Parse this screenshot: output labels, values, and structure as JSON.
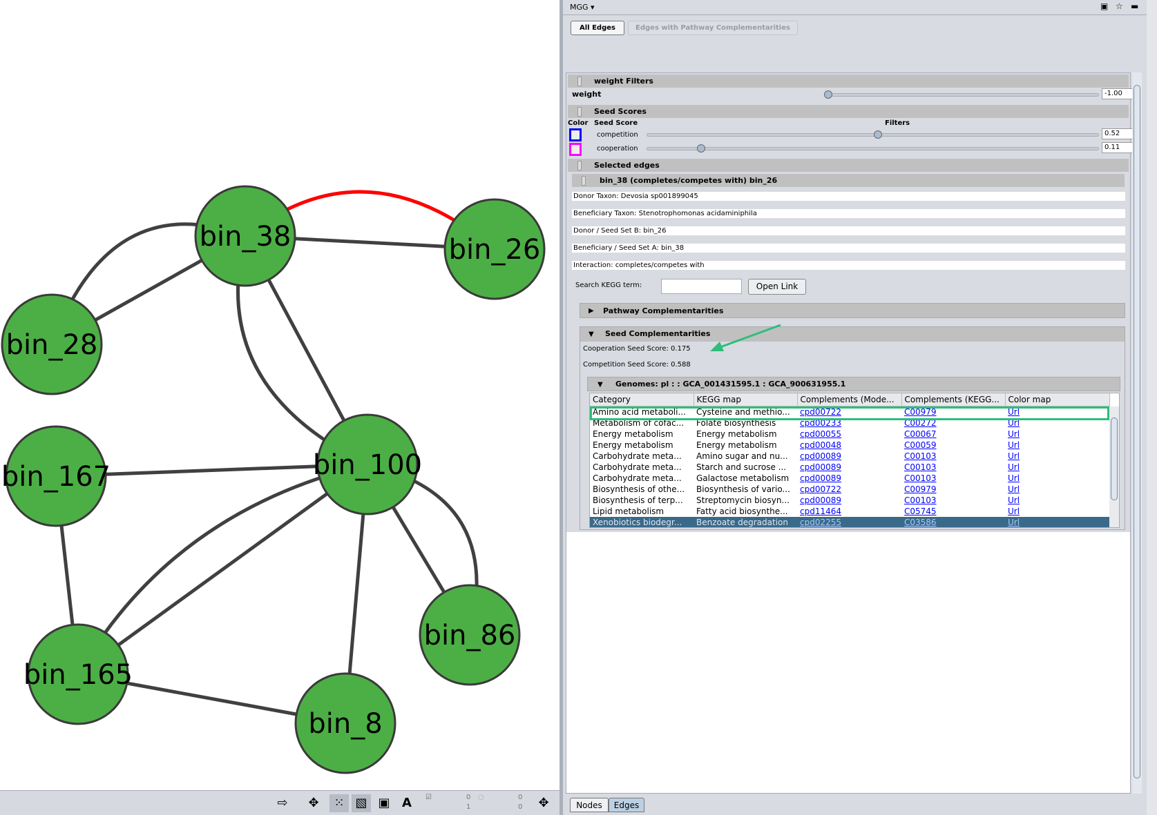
{
  "network": {
    "nodes": [
      {
        "id": "bin_38",
        "color": "#4caf45"
      },
      {
        "id": "bin_26",
        "color": "#4caf45"
      },
      {
        "id": "bin_28",
        "color": "#4caf45"
      },
      {
        "id": "bin_167",
        "color": "#4caf45"
      },
      {
        "id": "bin_100",
        "color": "#4caf45"
      },
      {
        "id": "bin_86",
        "color": "#4caf45"
      },
      {
        "id": "bin_165",
        "color": "#4caf45"
      },
      {
        "id": "bin_8",
        "color": "#4caf45"
      }
    ],
    "edges": [
      {
        "source": "bin_38",
        "target": "bin_26",
        "color": "#ff0000",
        "selected": true
      },
      {
        "source": "bin_38",
        "target": "bin_26"
      },
      {
        "source": "bin_38",
        "target": "bin_28"
      },
      {
        "source": "bin_38",
        "target": "bin_28"
      },
      {
        "source": "bin_38",
        "target": "bin_100"
      },
      {
        "source": "bin_38",
        "target": "bin_100"
      },
      {
        "source": "bin_167",
        "target": "bin_100"
      },
      {
        "source": "bin_167",
        "target": "bin_165"
      },
      {
        "source": "bin_165",
        "target": "bin_100"
      },
      {
        "source": "bin_165",
        "target": "bin_100"
      },
      {
        "source": "bin_100",
        "target": "bin_86"
      },
      {
        "source": "bin_100",
        "target": "bin_86"
      },
      {
        "source": "bin_100",
        "target": "bin_8"
      },
      {
        "source": "bin_165",
        "target": "bin_8"
      }
    ]
  },
  "toolbar": {
    "icons": [
      "export-icon",
      "layout-icon",
      "select-nodes-icon",
      "select-edges-icon",
      "annotation-icon",
      "text-icon"
    ],
    "counts": {
      "selected_nodes": "0",
      "total_nodes": "1",
      "hidden_a": "0",
      "hidden_b": "0"
    }
  },
  "panel": {
    "title": "MGG ▾",
    "tabs": {
      "all_edges": "All Edges",
      "pathway_edges": "Edges with Pathway Complementarities"
    },
    "weight_filters": {
      "header": "weight Filters",
      "label": "weight",
      "value": "-1.00",
      "slider_fraction": 0.0
    },
    "seed_scores": {
      "header": "Seed Scores",
      "col_color": "Color",
      "col_score": "Seed Score",
      "col_filters": "Filters",
      "rows": [
        {
          "label": "competition",
          "value": "0.52",
          "color": "#0000ff"
        },
        {
          "label": "cooperation",
          "value": "0.11",
          "color": "#ff00ff"
        }
      ]
    },
    "selected_edges": {
      "header": "Selected edges",
      "edge_title": "bin_38 (completes/competes with) bin_26",
      "fields": [
        "Donor Taxon: Devosia sp001899045",
        "Beneficiary Taxon: Stenotrophomonas acidaminiphila",
        "Donor / Seed Set B: bin_26",
        "Beneficiary / Seed Set A: bin_38",
        "Interaction: completes/competes with"
      ],
      "search_label": "Search KEGG term:",
      "search_value": "",
      "open_link": "Open Link",
      "pathway_header": "Pathway Complementarities",
      "seed_header": "Seed Complementarities",
      "coop_score": "Cooperation Seed Score: 0.175",
      "comp_score": "Competition Seed Score: 0.588",
      "genomes_header": "Genomes: pl : : GCA_001431595.1 : GCA_900631955.1",
      "table": {
        "columns": [
          "Category",
          "KEGG map",
          "Complements (Mode...",
          "Complements (KEGG...",
          "Color map"
        ],
        "rows": [
          [
            "Amino acid metaboli...",
            "Cysteine and methio...",
            "cpd00722",
            "C00979",
            "Url"
          ],
          [
            "Metabolism of cofac...",
            "Folate biosynthesis",
            "cpd00233",
            "C00272",
            "Url"
          ],
          [
            "Energy metabolism",
            "Energy metabolism",
            "cpd00055",
            "C00067",
            "Url"
          ],
          [
            "Energy metabolism",
            "Energy metabolism",
            "cpd00048",
            "C00059",
            "Url"
          ],
          [
            "Carbohydrate meta...",
            "Amino sugar and nu...",
            "cpd00089",
            "C00103",
            "Url"
          ],
          [
            "Carbohydrate meta...",
            "Starch and sucrose ...",
            "cpd00089",
            "C00103",
            "Url"
          ],
          [
            "Carbohydrate meta...",
            "Galactose metabolism",
            "cpd00089",
            "C00103",
            "Url"
          ],
          [
            "Biosynthesis of othe...",
            "Biosynthesis of vario...",
            "cpd00722",
            "C00979",
            "Url"
          ],
          [
            "Biosynthesis of terp...",
            "Streptomycin biosyn...",
            "cpd00089",
            "C00103",
            "Url"
          ],
          [
            "Lipid metabolism",
            "Fatty acid biosynthe...",
            "cpd11464",
            "C05745",
            "Url"
          ],
          [
            "Xenobiotics biodegr...",
            "Benzoate degradation",
            "cpd02255",
            "C03586",
            "Url"
          ]
        ]
      }
    },
    "bottom_tabs": [
      "Nodes",
      "Edges"
    ],
    "highlight_color": "#2ebd7a"
  }
}
